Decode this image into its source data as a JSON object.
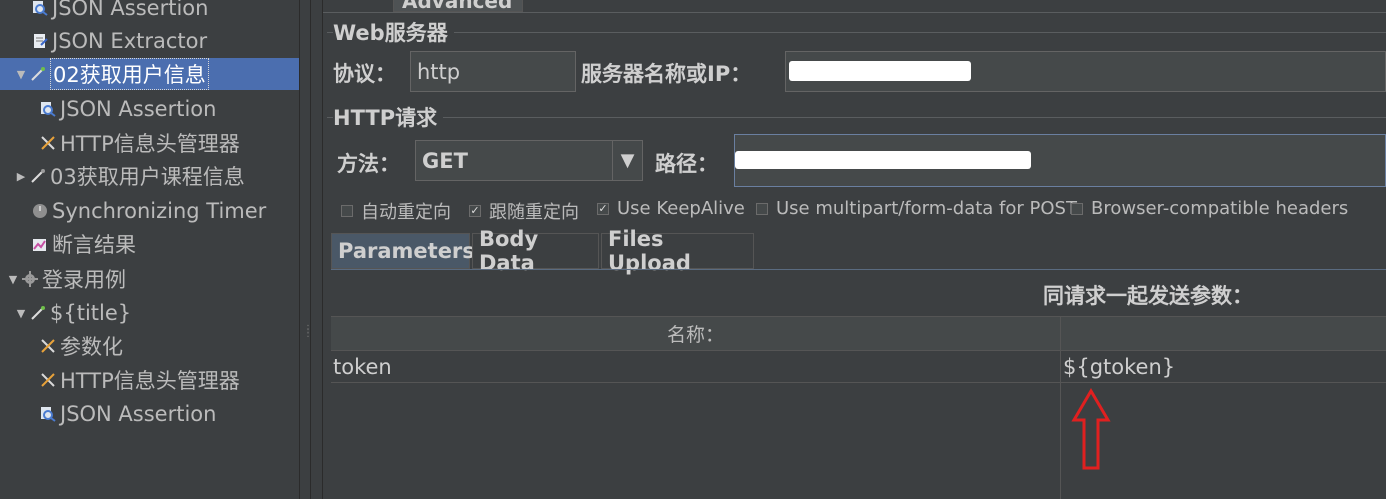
{
  "tree": {
    "items": [
      {
        "label": "JSON Assertion",
        "icon": "magnifier-icon"
      },
      {
        "label": "JSON Extractor",
        "icon": "extractor-icon"
      },
      {
        "label": "02获取用户信息",
        "icon": "pipette-icon",
        "arrow": "▼"
      },
      {
        "label": "JSON Assertion",
        "icon": "magnifier-icon"
      },
      {
        "label": "HTTP信息头管理器",
        "icon": "wrench-icon"
      },
      {
        "label": "03获取用户课程信息",
        "icon": "pipette-icon",
        "arrow": "▶"
      },
      {
        "label": "Synchronizing Timer",
        "icon": "timer-icon"
      },
      {
        "label": "断言结果",
        "icon": "chart-icon"
      },
      {
        "label": "登录用例",
        "icon": "gear-icon",
        "arrow": "▼"
      },
      {
        "label": "${title}",
        "icon": "pipette-icon",
        "arrow": "▼"
      },
      {
        "label": "参数化",
        "icon": "wrench-icon"
      },
      {
        "label": "HTTP信息头管理器",
        "icon": "wrench-icon"
      },
      {
        "label": "JSON Assertion",
        "icon": "magnifier-icon"
      }
    ]
  },
  "top_tab": "Advanced",
  "web_server": {
    "legend": "Web服务器",
    "protocol_label": "协议：",
    "protocol_value": "http",
    "server_label": "服务器名称或IP："
  },
  "http_request": {
    "legend": "HTTP请求",
    "method_label": "方法：",
    "method_value": "GET",
    "path_label": "路径："
  },
  "options": [
    {
      "label": "自动重定向",
      "checked": false
    },
    {
      "label": "跟随重定向",
      "checked": true
    },
    {
      "label": "Use KeepAlive",
      "checked": true
    },
    {
      "label": "Use multipart/form-data for POST",
      "checked": false
    },
    {
      "label": "Browser-compatible headers",
      "checked": false
    }
  ],
  "tabs": [
    "Parameters",
    "Body Data",
    "Files Upload"
  ],
  "params": {
    "header": "同请求一起发送参数：",
    "columns": [
      "名称：",
      ""
    ],
    "rows": [
      {
        "name": "token",
        "value": "${gtoken}"
      }
    ]
  },
  "colors": {
    "selection": "#4b6eaf",
    "arrow": "#e02020",
    "redaction": "#ffffff"
  }
}
